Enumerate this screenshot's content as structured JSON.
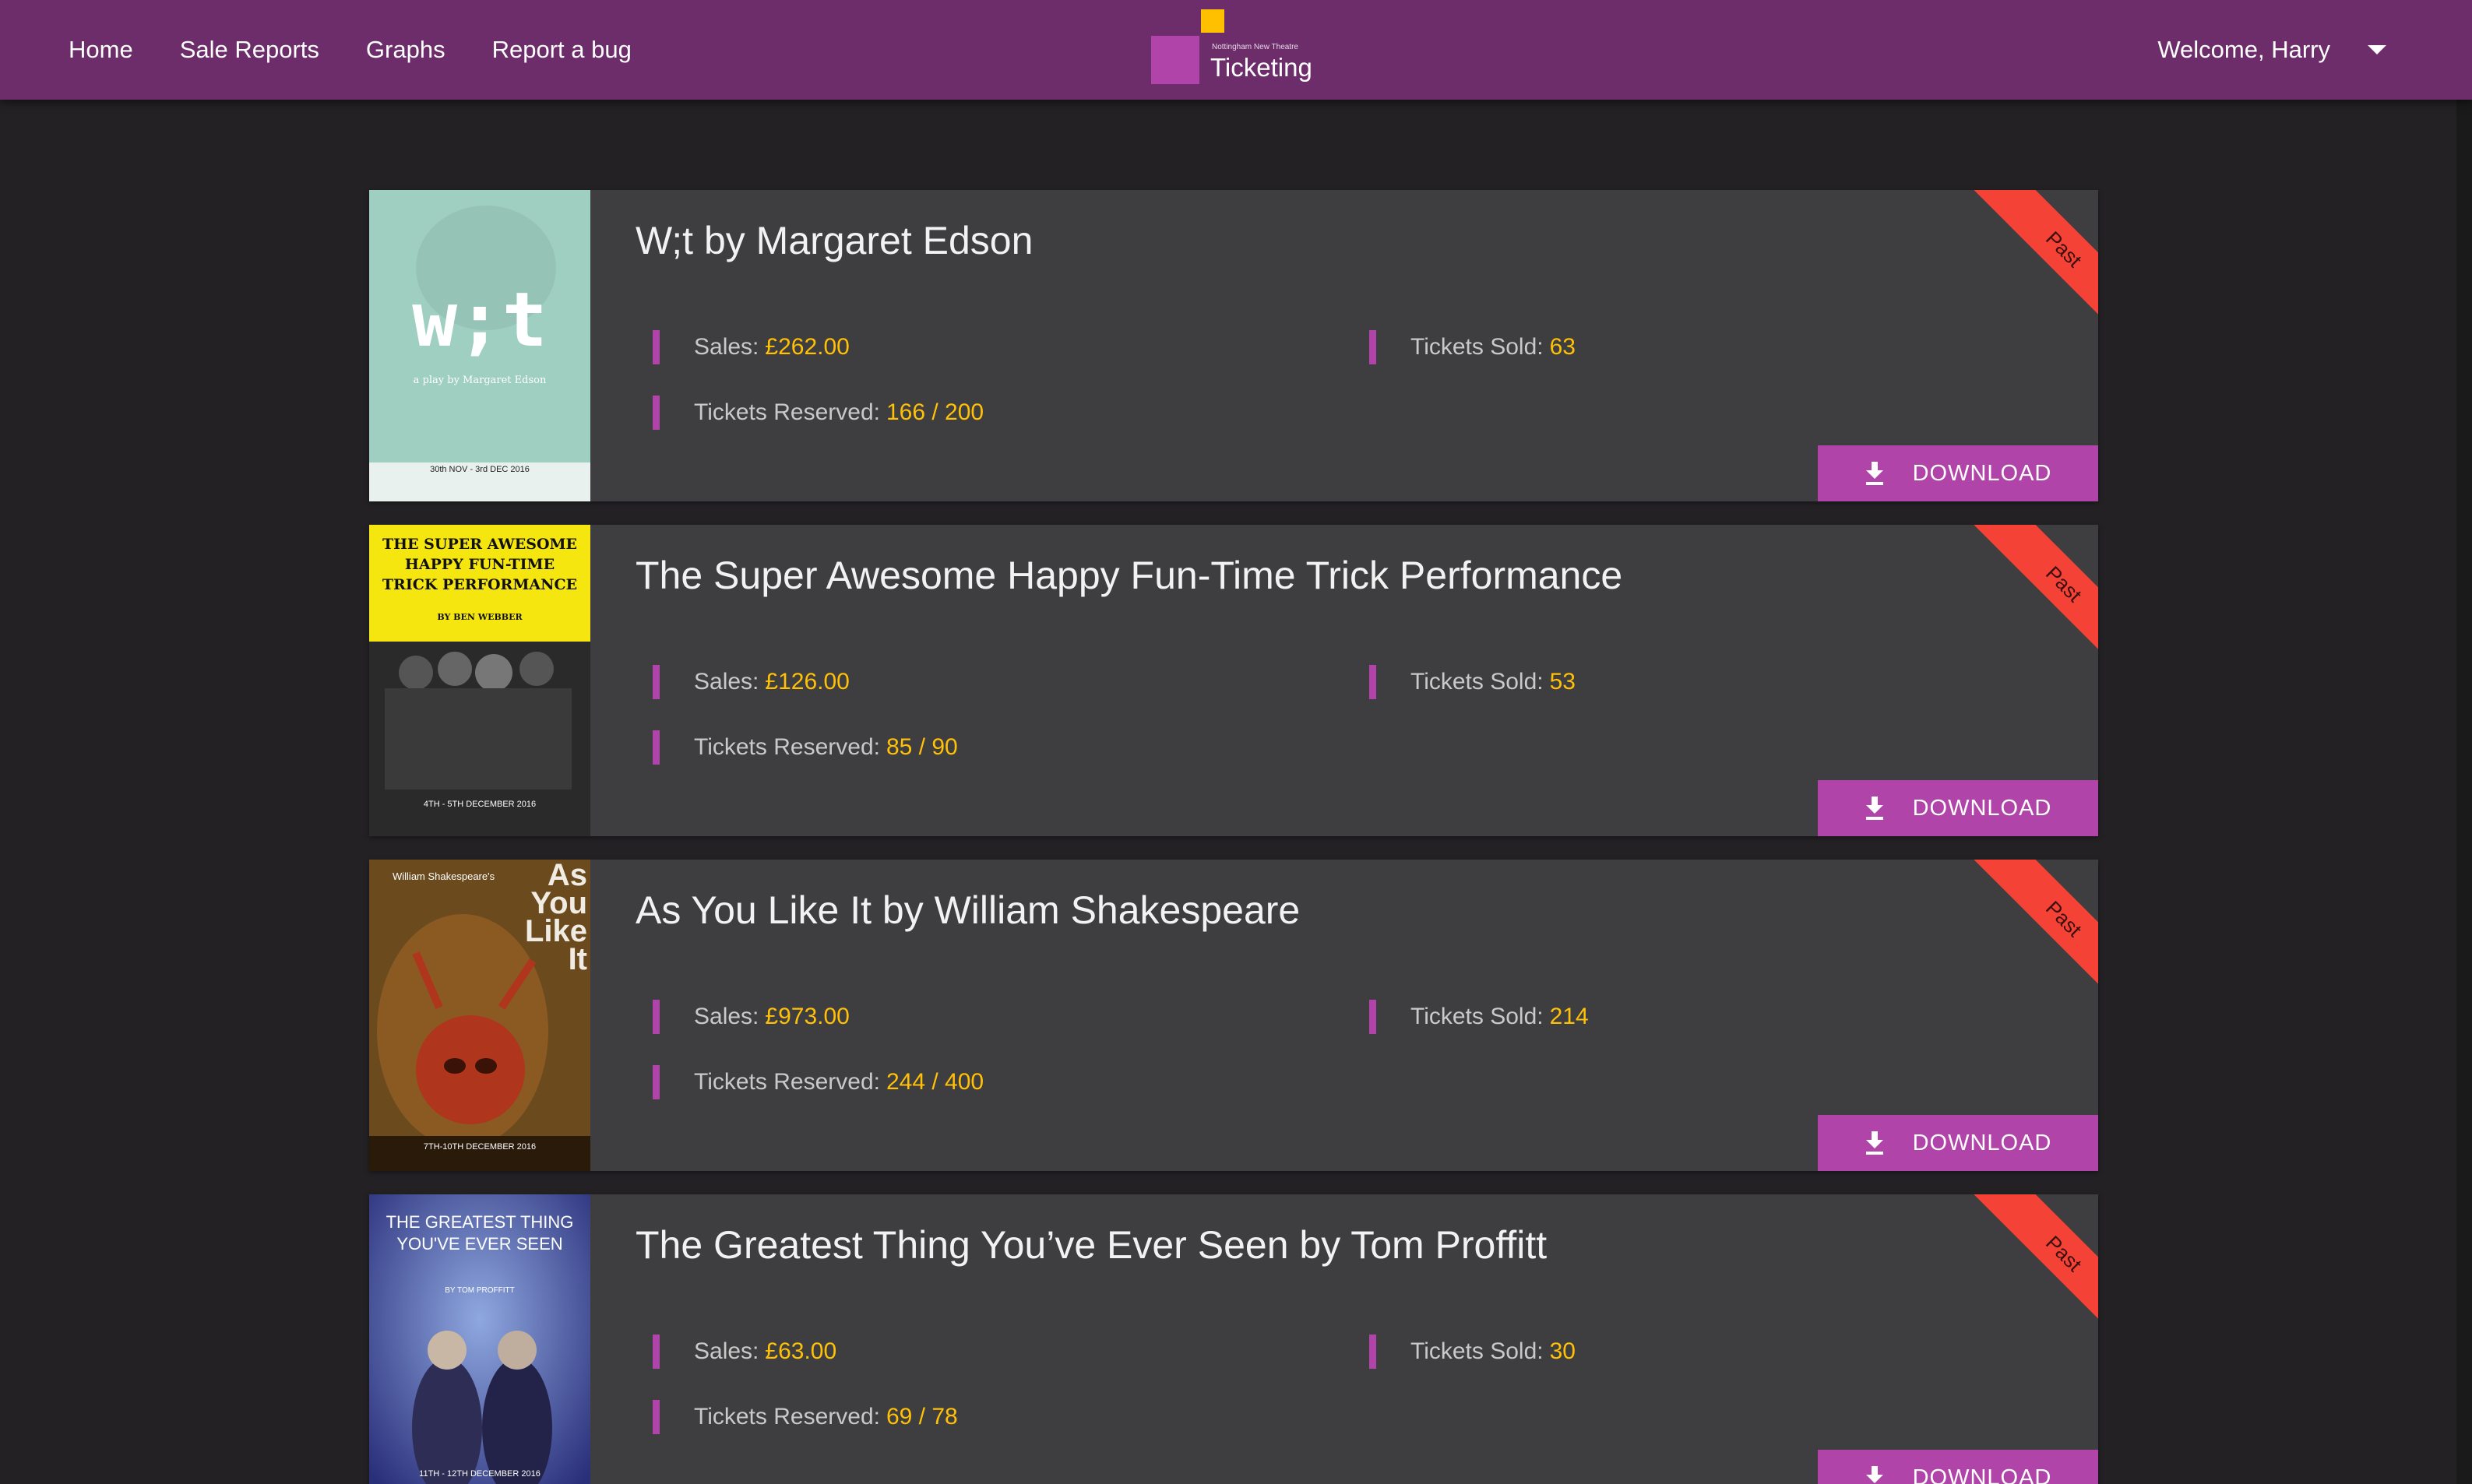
{
  "nav": {
    "links": [
      "Home",
      "Sale Reports",
      "Graphs",
      "Report a bug"
    ],
    "logo_sub": "Nottingham New Theatre",
    "logo_name": "Ticketing",
    "welcome": "Welcome, Harry"
  },
  "labels": {
    "sales": "Sales:",
    "tickets_sold": "Tickets Sold:",
    "tickets_reserved": "Tickets Reserved:",
    "download": "DOWNLOAD",
    "status": "Past"
  },
  "shows": [
    {
      "title": "W;t by Margaret Edson",
      "sales": "£262.00",
      "tickets_sold": "63",
      "tickets_reserved": "166 / 200",
      "status": "Past",
      "poster": {
        "bg": "#9fcfc1",
        "headline": "w;t",
        "subline": "a play by Margaret Edson",
        "footer": "30th NOV - 3rd DEC 2016"
      }
    },
    {
      "title": "The Super Awesome Happy Fun-Time Trick Performance",
      "sales": "£126.00",
      "tickets_sold": "53",
      "tickets_reserved": "85 / 90",
      "status": "Past",
      "poster": {
        "bg": "#f5e60f",
        "headline": "THE SUPER AWESOME HAPPY FUN-TIME TRICK PERFORMANCE",
        "subline": "BY BEN WEBBER",
        "footer": "4TH - 5TH DECEMBER 2016"
      }
    },
    {
      "title": "As You Like It by William Shakespeare",
      "sales": "£973.00",
      "tickets_sold": "214",
      "tickets_reserved": "244 / 400",
      "status": "Past",
      "poster": {
        "bg": "#6b4a1d",
        "headline": "As You Like It",
        "subline": "William Shakespeare's",
        "footer": "7TH-10TH DECEMBER 2016"
      }
    },
    {
      "title": "The Greatest Thing You’ve Ever Seen by Tom Proffitt",
      "sales": "£63.00",
      "tickets_sold": "30",
      "tickets_reserved": "69 / 78",
      "status": "Past",
      "poster": {
        "bg": "#3b3f8f",
        "headline": "THE GREATEST THING YOU'VE EVER SEEN",
        "subline": "BY TOM PROFFITT",
        "footer": "11TH - 12TH DECEMBER 2016"
      }
    }
  ]
}
